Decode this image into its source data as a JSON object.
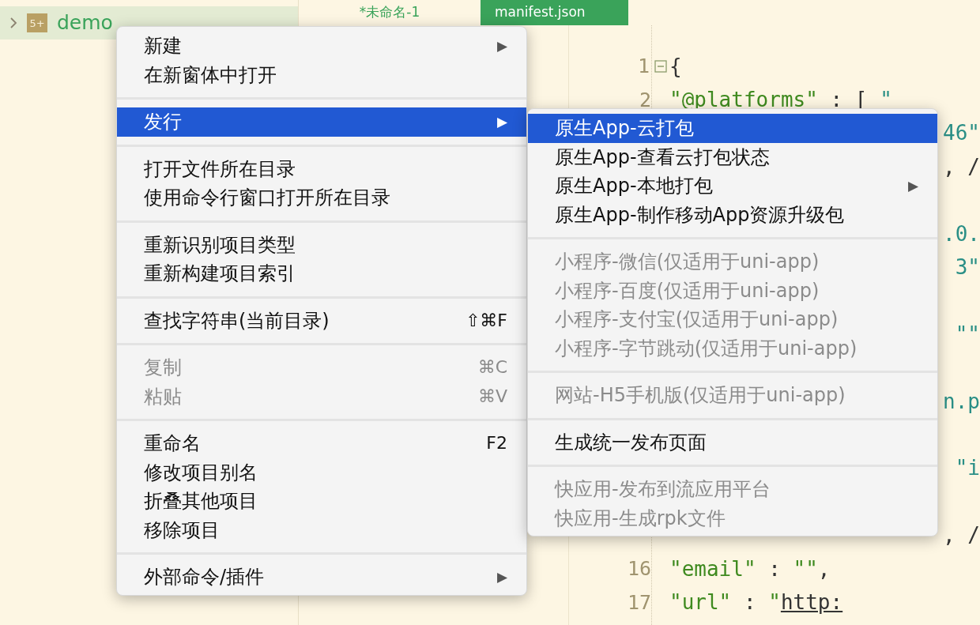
{
  "sidebar": {
    "project": {
      "name": "demo",
      "icon_text": "5+",
      "expanded": false
    }
  },
  "tabs": [
    {
      "label": "*未命名-1",
      "selected": false
    },
    {
      "label": "manifest.json",
      "selected": true
    }
  ],
  "editor": {
    "lines": [
      {
        "kind": "code",
        "number": "1",
        "fold": true,
        "tokens": [
          {
            "kind": "punct",
            "text": "{"
          }
        ]
      },
      {
        "kind": "code",
        "number": "2",
        "tokens": [
          {
            "kind": "key",
            "text": "\"@platforms\""
          },
          {
            "kind": "punct",
            "text": " : [ "
          },
          {
            "kind": "value",
            "text": "\""
          }
        ]
      },
      {
        "kind": "tail",
        "tokens": [
          {
            "kind": "value",
            "text": "46\""
          }
        ]
      },
      {
        "kind": "tail",
        "tokens": [
          {
            "kind": "punct",
            "text": ", /"
          }
        ]
      },
      {
        "kind": "blank"
      },
      {
        "kind": "tail",
        "tokens": [
          {
            "kind": "value",
            "text": ".0."
          }
        ]
      },
      {
        "kind": "tail",
        "tokens": [
          {
            "kind": "value",
            "text": "3\""
          }
        ]
      },
      {
        "kind": "blank"
      },
      {
        "kind": "tail",
        "tokens": [
          {
            "kind": "value",
            "text": "\"\""
          }
        ]
      },
      {
        "kind": "blank"
      },
      {
        "kind": "tail",
        "tokens": [
          {
            "kind": "value",
            "text": "n.p"
          }
        ]
      },
      {
        "kind": "blank"
      },
      {
        "kind": "tail",
        "tokens": [
          {
            "kind": "value",
            "text": "\"i"
          }
        ]
      },
      {
        "kind": "blank"
      },
      {
        "kind": "tail",
        "tokens": [
          {
            "kind": "punct",
            "text": ", /"
          }
        ]
      },
      {
        "kind": "code",
        "number": "16",
        "tokens": [
          {
            "kind": "key",
            "text": "\"email\""
          },
          {
            "kind": "punct",
            "text": " : "
          },
          {
            "kind": "key",
            "text": "\"\""
          },
          {
            "kind": "punct",
            "text": ","
          }
        ]
      },
      {
        "kind": "code",
        "number": "17",
        "tokens": [
          {
            "kind": "key",
            "text": "\"url\""
          },
          {
            "kind": "punct",
            "text": " : "
          },
          {
            "kind": "key",
            "text": "\""
          },
          {
            "kind": "url",
            "text": "http:"
          }
        ]
      }
    ]
  },
  "context_menu": {
    "groups": [
      [
        {
          "label": "新建",
          "submenu_arrow": "▶",
          "disabled": false,
          "selected": false
        },
        {
          "label": "在新窗体中打开",
          "disabled": false,
          "selected": false
        }
      ],
      [
        {
          "label": "发行",
          "submenu_arrow": "▶",
          "disabled": false,
          "selected": true
        }
      ],
      [
        {
          "label": "打开文件所在目录",
          "disabled": false,
          "selected": false
        },
        {
          "label": "使用命令行窗口打开所在目录",
          "disabled": false,
          "selected": false
        }
      ],
      [
        {
          "label": "重新识别项目类型",
          "disabled": false,
          "selected": false
        },
        {
          "label": "重新构建项目索引",
          "disabled": false,
          "selected": false
        }
      ],
      [
        {
          "label": "查找字符串(当前目录)",
          "shortcut": "⇧⌘F",
          "disabled": false,
          "selected": false
        }
      ],
      [
        {
          "label": "复制",
          "shortcut": "⌘C",
          "disabled": true,
          "selected": false
        },
        {
          "label": "粘贴",
          "shortcut": "⌘V",
          "disabled": true,
          "selected": false
        }
      ],
      [
        {
          "label": "重命名",
          "shortcut": "F2",
          "disabled": false,
          "selected": false
        },
        {
          "label": "修改项目别名",
          "disabled": false,
          "selected": false
        },
        {
          "label": "折叠其他项目",
          "disabled": false,
          "selected": false
        },
        {
          "label": "移除项目",
          "disabled": false,
          "selected": false
        }
      ],
      [
        {
          "label": "外部命令/插件",
          "submenu_arrow": "▶",
          "disabled": false,
          "selected": false
        }
      ]
    ]
  },
  "submenu": {
    "groups": [
      [
        {
          "label": "原生App-云打包",
          "disabled": false,
          "selected": true
        },
        {
          "label": "原生App-查看云打包状态",
          "disabled": false,
          "selected": false
        },
        {
          "label": "原生App-本地打包",
          "submenu_arrow": "▶",
          "disabled": false,
          "selected": false
        },
        {
          "label": "原生App-制作移动App资源升级包",
          "disabled": false,
          "selected": false
        }
      ],
      [
        {
          "label": "小程序-微信(仅适用于uni-app)",
          "disabled": true,
          "selected": false
        },
        {
          "label": "小程序-百度(仅适用于uni-app)",
          "disabled": true,
          "selected": false
        },
        {
          "label": "小程序-支付宝(仅适用于uni-app)",
          "disabled": true,
          "selected": false
        },
        {
          "label": "小程序-字节跳动(仅适用于uni-app)",
          "disabled": true,
          "selected": false
        }
      ],
      [
        {
          "label": "网站-H5手机版(仅适用于uni-app)",
          "disabled": true,
          "selected": false
        }
      ],
      [
        {
          "label": "生成统一发布页面",
          "disabled": false,
          "selected": false
        }
      ],
      [
        {
          "label": "快应用-发布到流应用平台",
          "disabled": true,
          "selected": false
        },
        {
          "label": "快应用-生成rpk文件",
          "disabled": true,
          "selected": false
        }
      ]
    ]
  }
}
